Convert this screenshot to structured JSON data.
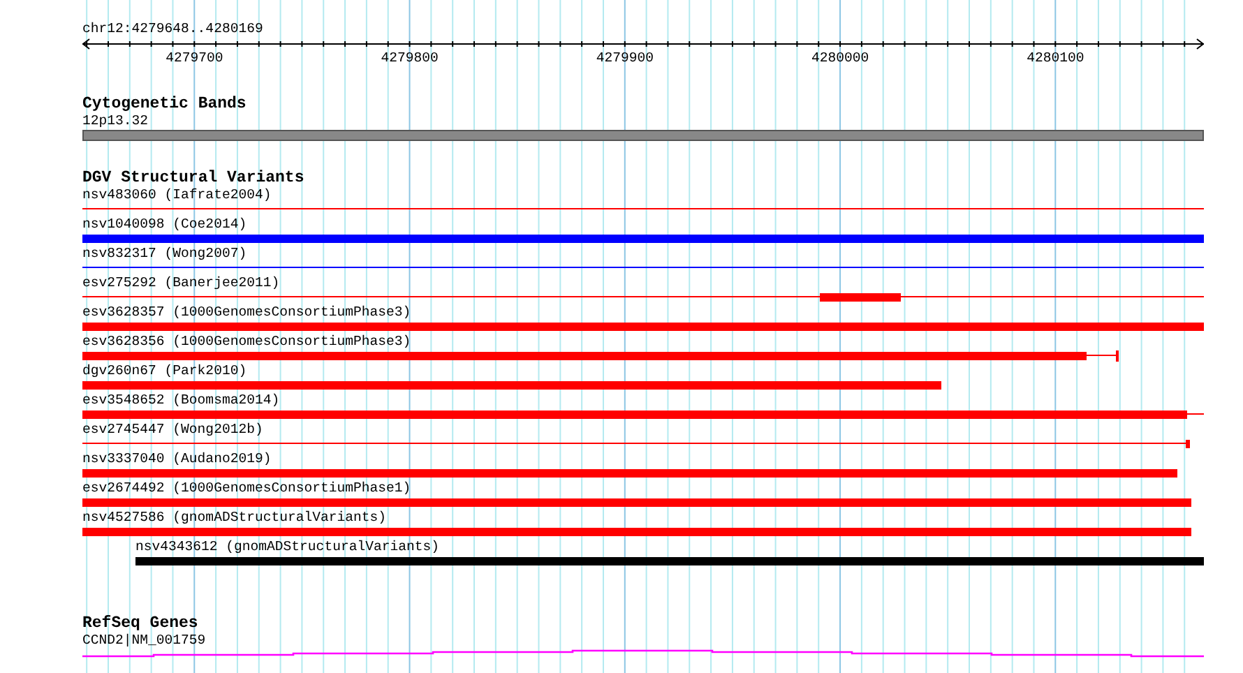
{
  "ruler": {
    "label": "chr12:4279648..4280169",
    "ticks": [
      "4279700",
      "4279800",
      "4279900",
      "4280000",
      "4280100"
    ]
  },
  "tracks": [
    {
      "title": "Cytogenetic Bands",
      "kind": "bands",
      "items": [
        {
          "label": "12p13.32"
        }
      ]
    },
    {
      "title": "DGV Structural Variants",
      "kind": "variants",
      "items": [
        {
          "label": "nsv483060 (Iafrate2004)",
          "color": "#ff0000"
        },
        {
          "label": "nsv1040098 (Coe2014)",
          "color": "#0000ff"
        },
        {
          "label": "nsv832317 (Wong2007)",
          "color": "#0000ff"
        },
        {
          "label": "esv275292 (Banerjee2011)",
          "color": "#ff0000"
        },
        {
          "label": "esv3628357 (1000GenomesConsortiumPhase3)",
          "color": "#ff0000"
        },
        {
          "label": "esv3628356 (1000GenomesConsortiumPhase3)",
          "color": "#ff0000"
        },
        {
          "label": "dgv260n67 (Park2010)",
          "color": "#ff0000"
        },
        {
          "label": "esv3548652 (Boomsma2014)",
          "color": "#ff0000"
        },
        {
          "label": "esv2745447 (Wong2012b)",
          "color": "#ff0000"
        },
        {
          "label": "nsv3337040 (Audano2019)",
          "color": "#ff0000"
        },
        {
          "label": "esv2674492 (1000GenomesConsortiumPhase1)",
          "color": "#ff0000"
        },
        {
          "label": "nsv4527586 (gnomADStructuralVariants)",
          "color": "#ff0000"
        },
        {
          "label": "nsv4343612 (gnomADStructuralVariants)",
          "color": "#000000"
        }
      ]
    },
    {
      "title": "RefSeq Genes",
      "kind": "genes",
      "items": [
        {
          "label": "CCND2|NM_001759"
        }
      ]
    }
  ]
}
